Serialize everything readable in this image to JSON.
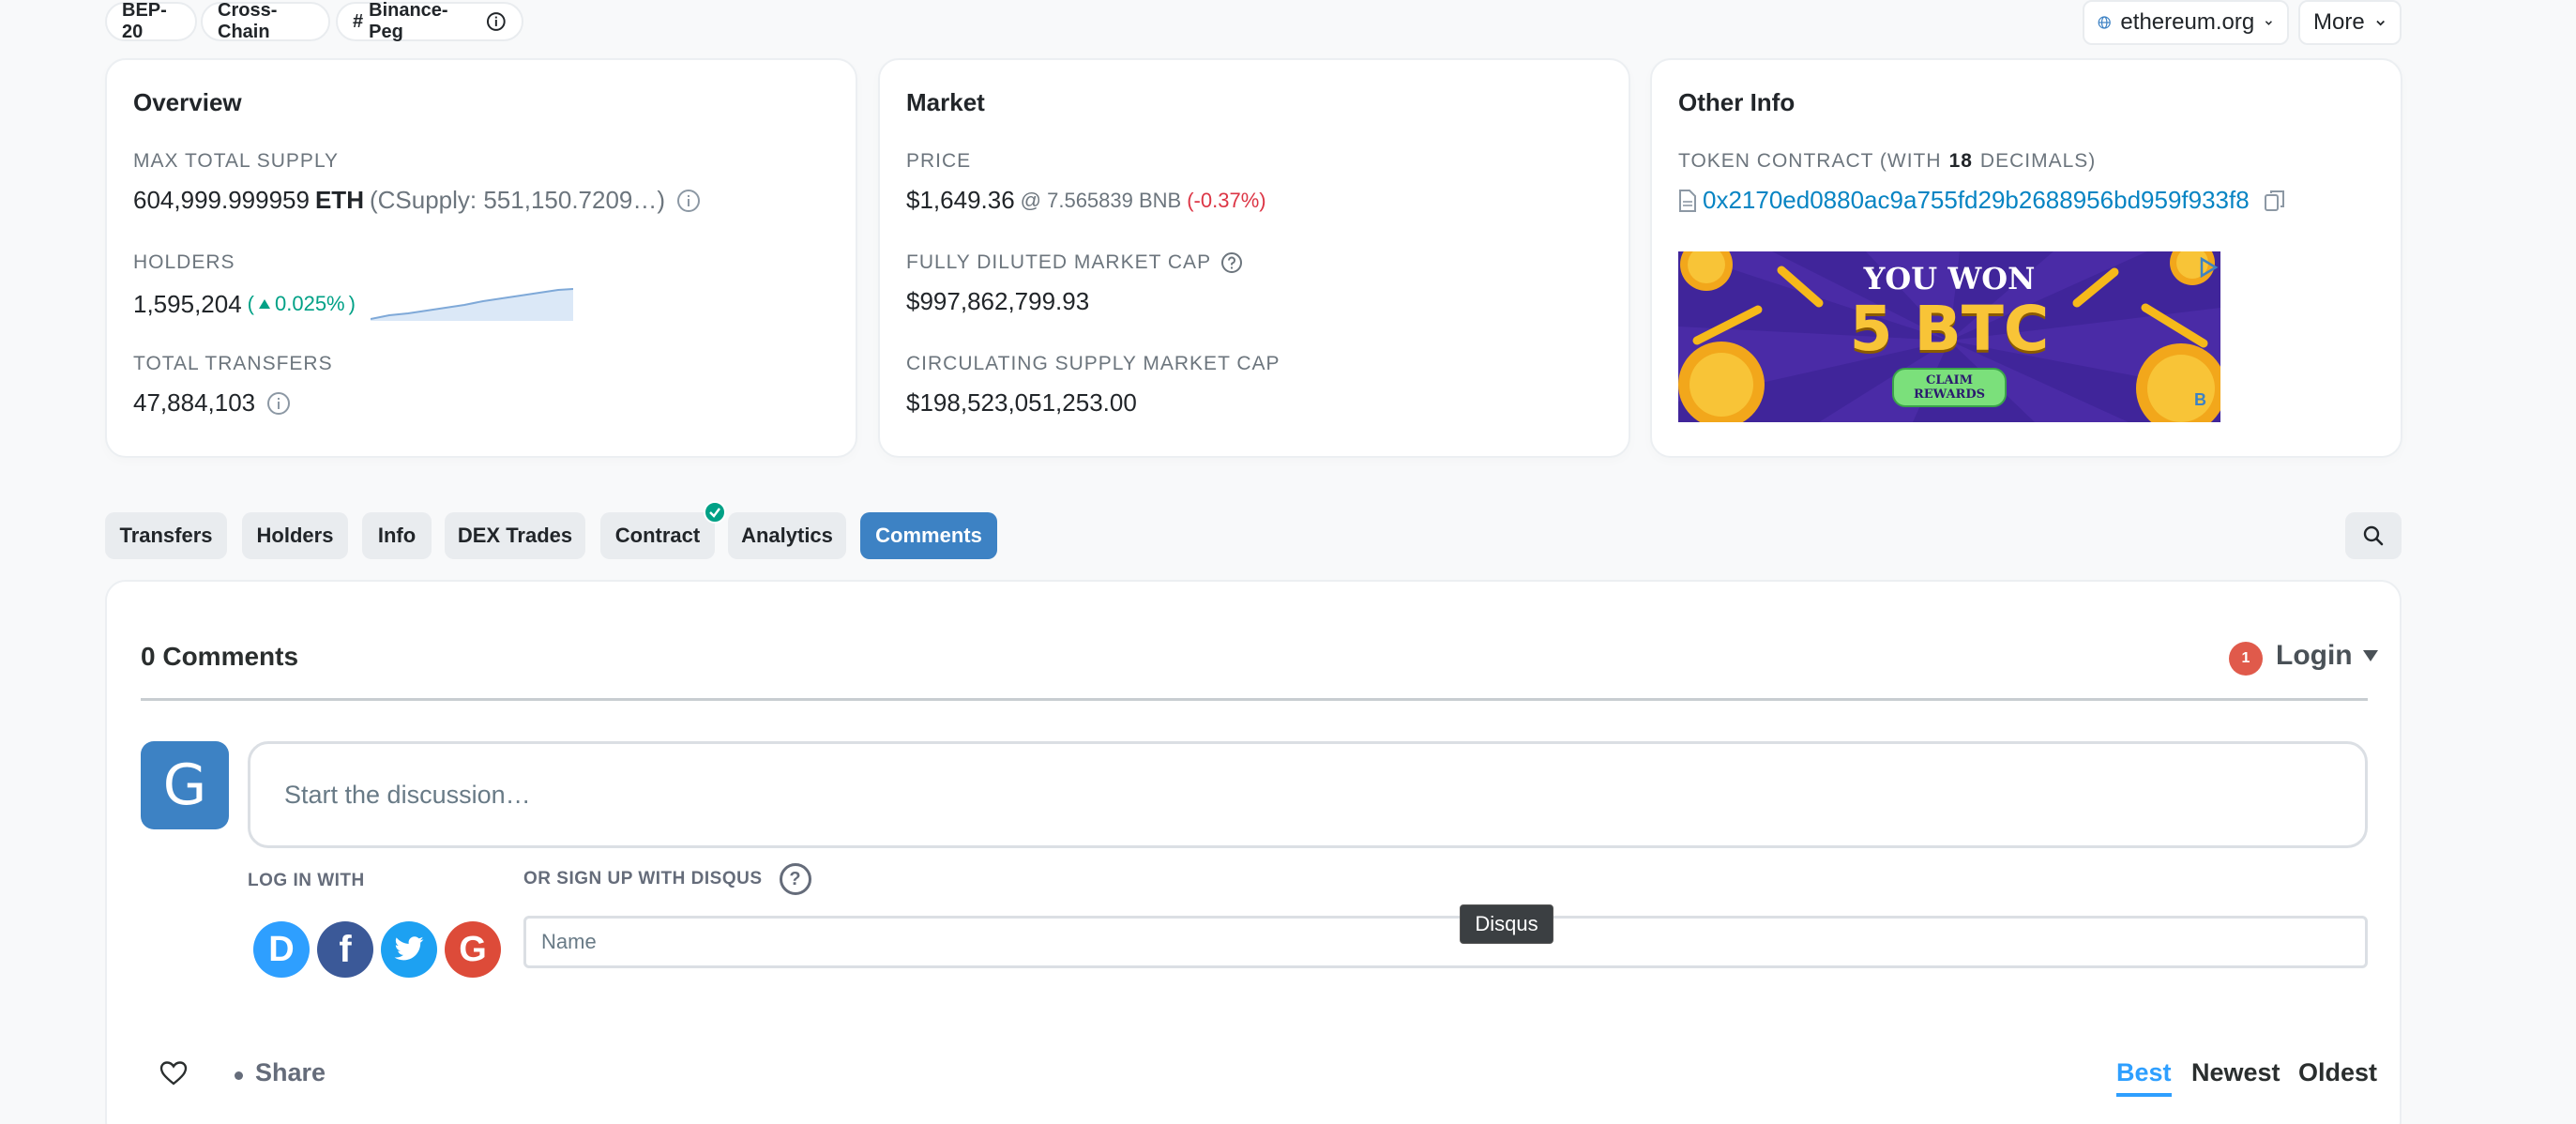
{
  "tags": {
    "bep20": "BEP-20",
    "crosschain": "Cross-Chain",
    "binancepeg_hash": "#",
    "binancepeg": "Binance-Peg"
  },
  "header": {
    "website": "ethereum.org",
    "more": "More"
  },
  "overview": {
    "title": "Overview",
    "max_supply_label": "MAX TOTAL SUPPLY",
    "max_supply_value": "604,999.999959",
    "max_supply_symbol": "ETH",
    "csupply": "(CSupply: 551,150.7209…)",
    "holders_label": "HOLDERS",
    "holders_value": "1,595,204",
    "holders_open": "(",
    "holders_change": "0.025%",
    "holders_close": ")",
    "transfers_label": "TOTAL TRANSFERS",
    "transfers_value": "47,884,103"
  },
  "market": {
    "title": "Market",
    "price_label": "PRICE",
    "price_value": "$1,649.36",
    "price_bnb": "@ 7.565839 BNB",
    "price_change": "(-0.37%)",
    "fdmc_label": "FULLY DILUTED MARKET CAP",
    "fdmc_value": "$997,862,799.93",
    "csmc_label": "CIRCULATING SUPPLY MARKET CAP",
    "csmc_value": "$198,523,051,253.00"
  },
  "other": {
    "title": "Other Info",
    "contract_label_pre": "TOKEN CONTRACT (WITH",
    "contract_decimals": "18",
    "contract_label_post": "DECIMALS)",
    "contract_address": "0x2170ed0880ac9a755fd29b2688956bd959f933f8"
  },
  "ad": {
    "line1": "YOU WON",
    "line2": "5 BTC",
    "button_line1": "CLAIM",
    "button_line2": "REWARDS",
    "corner": "B"
  },
  "tabs": {
    "transfers": "Transfers",
    "holders": "Holders",
    "info": "Info",
    "dex": "DEX Trades",
    "contract": "Contract",
    "analytics": "Analytics",
    "comments": "Comments"
  },
  "comments": {
    "count": "0 Comments",
    "notif": "1",
    "login": "Login",
    "avatar_letter": "G",
    "placeholder": "Start the discussion…",
    "login_with": "LOG IN WITH",
    "signup": "OR SIGN UP WITH DISQUS",
    "help": "?",
    "tooltip": "Disqus",
    "name_placeholder": "Name",
    "disqus_letter": "D",
    "facebook_letter": "f",
    "google_letter": "G",
    "share": "Share",
    "sort_best": "Best",
    "sort_newest": "Newest",
    "sort_oldest": "Oldest"
  },
  "colors": {
    "accent": "#3d82c4",
    "positive": "#00a186",
    "negative": "#dc3545",
    "disqus_blue": "#2e9fff",
    "facebook": "#3b5998",
    "twitter": "#1da1f2",
    "google": "#dd4b39"
  }
}
